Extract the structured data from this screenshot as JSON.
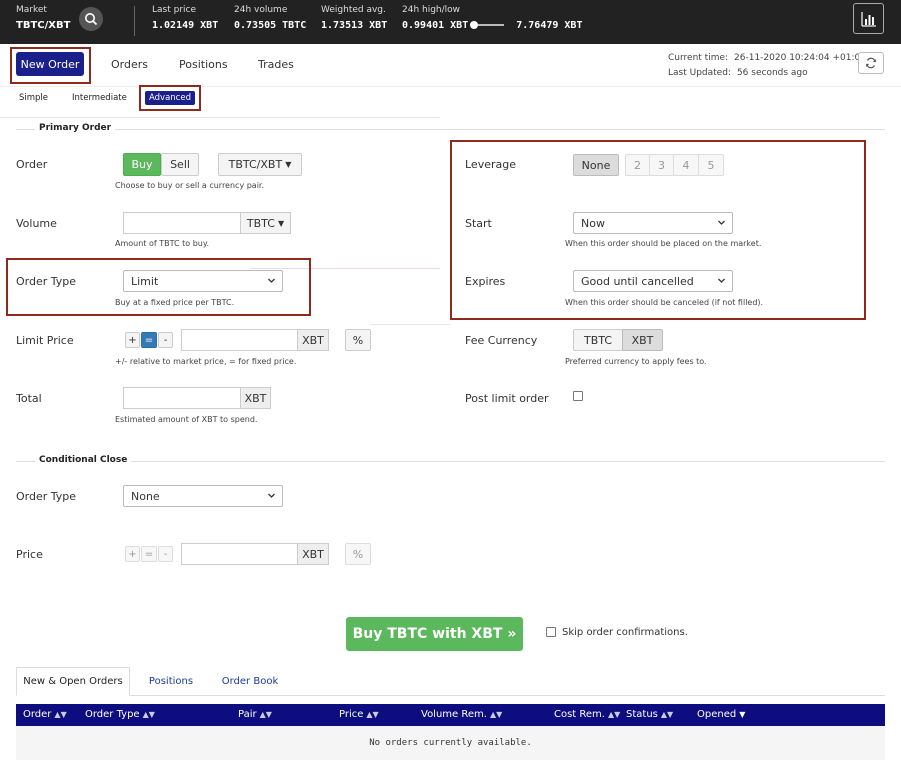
{
  "topbar": {
    "market_label": "Market",
    "market_value": "TBTC/XBT",
    "stats": [
      {
        "label": "Last price",
        "value": "1.02149 XBT"
      },
      {
        "label": "24h volume",
        "value": "0.73505 TBTC"
      },
      {
        "label": "Weighted avg.",
        "value": "1.73513 XBT"
      }
    ],
    "highlow_label": "24h high/low",
    "low_value": "0.99401 XBT",
    "high_value": "7.76479 XBT"
  },
  "nav": {
    "new_order": "New Order",
    "orders": "Orders",
    "positions": "Positions",
    "trades": "Trades"
  },
  "time": {
    "current_label": "Current time:",
    "current_value": "26-11-2020 10:24:04 +01:00",
    "updated_label": "Last Updated:",
    "updated_value": "56 seconds ago"
  },
  "modes": {
    "simple": "Simple",
    "intermediate": "Intermediate",
    "advanced": "Advanced"
  },
  "primary": {
    "title": "Primary Order",
    "order_label": "Order",
    "buy": "Buy",
    "sell": "Sell",
    "pair": "TBTC/XBT",
    "order_help": "Choose to buy or sell a currency pair.",
    "volume_label": "Volume",
    "volume_value": "",
    "volume_unit": "TBTC",
    "volume_help": "Amount of TBTC to buy.",
    "ordertype_label": "Order Type",
    "ordertype_value": "Limit",
    "ordertype_help": "Buy at a fixed price per TBTC.",
    "limit_label": "Limit Price",
    "plus": "+",
    "equals": "=",
    "minus": "-",
    "limit_unit": "XBT",
    "percent": "%",
    "limit_help": "+/- relative to market price, = for fixed price.",
    "total_label": "Total",
    "total_unit": "XBT",
    "total_help": "Estimated amount of XBT to spend."
  },
  "right": {
    "leverage_label": "Leverage",
    "leverage_options": [
      "None",
      "2",
      "3",
      "4",
      "5"
    ],
    "start_label": "Start",
    "start_value": "Now",
    "start_help": "When this order should be placed on the market.",
    "expires_label": "Expires",
    "expires_value": "Good until cancelled",
    "expires_help": "When this order should be canceled (if not filled).",
    "fee_label": "Fee Currency",
    "fee_options": [
      "TBTC",
      "XBT"
    ],
    "fee_help": "Preferred currency to apply fees to.",
    "postlimit_label": "Post limit order"
  },
  "conditional": {
    "title": "Conditional Close",
    "ordertype_label": "Order Type",
    "ordertype_value": "None",
    "price_label": "Price",
    "plus": "+",
    "equals": "=",
    "minus": "-",
    "price_unit": "XBT",
    "percent": "%"
  },
  "submit": {
    "buy_button": "Buy TBTC with XBT »",
    "skip_label": "Skip order confirmations."
  },
  "tabs": [
    "New & Open Orders",
    "Positions",
    "Order Book"
  ],
  "table": {
    "columns": [
      "Order",
      "Order Type",
      "Pair",
      "Price",
      "Volume Rem.",
      "Cost Rem.",
      "Status",
      "Opened"
    ],
    "empty": "No orders currently available."
  },
  "colors": {
    "brand": "#1a1f8c",
    "buy": "#5cb85c",
    "highlight_box": "#8b2a1d",
    "topbar": "#222222"
  }
}
